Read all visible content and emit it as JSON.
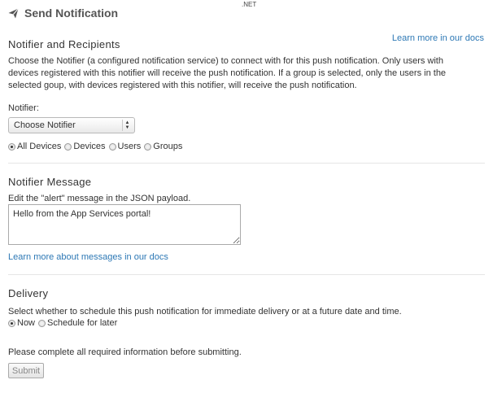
{
  "top_note": ".NET",
  "header": {
    "title": "Send Notification",
    "icon": "send-icon"
  },
  "recipients": {
    "title": "Notifier and Recipients",
    "docs_link": "Learn more in our docs",
    "description_lines": [
      "Choose the Notifier (a configured notification service) to connect with for this push notification. Only users with",
      "devices registered with this notifier will receive the push notification. If a group is selected, only the users in the",
      "selected goup, with devices registered with this notifier, will receive the push notification."
    ],
    "notifier_label": "Notifier:",
    "notifier_select": "Choose Notifier",
    "targets": [
      {
        "label": "All Devices",
        "checked": true
      },
      {
        "label": "Devices",
        "checked": false
      },
      {
        "label": "Users",
        "checked": false
      },
      {
        "label": "Groups",
        "checked": false
      }
    ]
  },
  "message": {
    "title": "Notifier Message",
    "description": "Edit the \"alert\" message in the JSON payload.",
    "value": "Hello from the App Services portal!",
    "docs_link": "Learn more about messages in our docs"
  },
  "delivery": {
    "title": "Delivery",
    "description": "Select whether to schedule this push notification for immediate delivery or at a future date and time.",
    "options": [
      {
        "label": "Now",
        "checked": true
      },
      {
        "label": "Schedule for later",
        "checked": false
      }
    ]
  },
  "footer": {
    "note": "Please complete all required information before submitting.",
    "submit_label": "Submit"
  }
}
